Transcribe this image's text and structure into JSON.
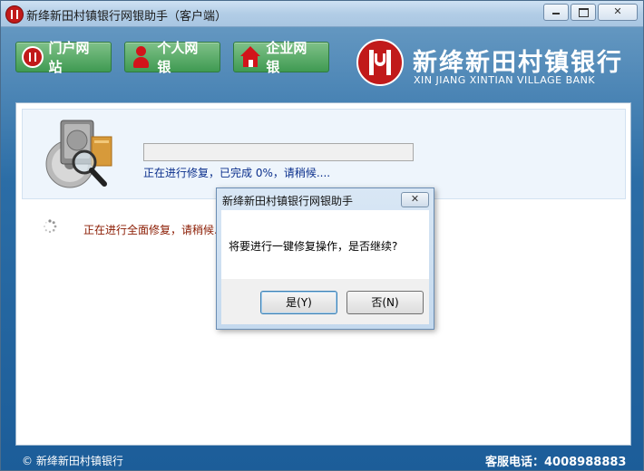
{
  "window": {
    "title": "新绛新田村镇银行网银助手（客户端）"
  },
  "nav": {
    "portal": "门户网站",
    "personal": "个人网银",
    "corporate": "企业网银"
  },
  "bank": {
    "name": "新绛新田村镇银行",
    "name_en": "XIN JIANG XINTIAN VILLAGE BANK"
  },
  "repair": {
    "progress_text": "正在进行修复，已完成 0%，请稍候....",
    "progress_percent": 0,
    "status_text": "正在进行全面修复，请稍候..."
  },
  "footer": {
    "copyright": "© 新绛新田村镇银行",
    "service": "客服电话：4008988883"
  },
  "dialog": {
    "title": "新绛新田村镇银行网银助手",
    "message": "将要进行一键修复操作，是否继续?",
    "yes_label": "是(Y)",
    "no_label": "否(N)"
  },
  "colors": {
    "nav_green": "#3f9a52",
    "brand_red": "#c11a1a",
    "progress_text": "#0b2f8c",
    "status_text": "#8a1a00"
  }
}
